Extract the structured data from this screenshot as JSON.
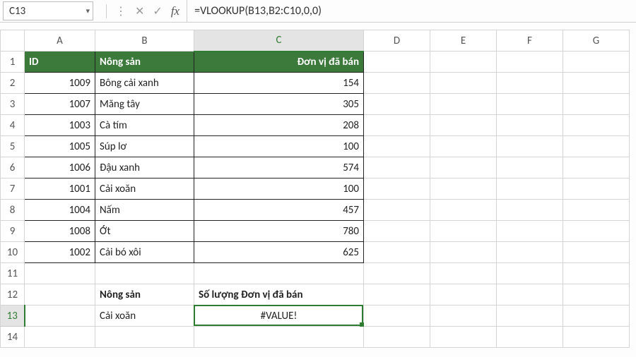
{
  "formula_bar": {
    "cell_ref": "C13",
    "formula": "=VLOOKUP(B13,B2:C10,0,0)",
    "icon_cancel": "✕",
    "icon_accept": "✓",
    "icon_fx": "fx",
    "icon_dropdown": "▾",
    "icon_sep": "⋮"
  },
  "columns": [
    "A",
    "B",
    "C",
    "D",
    "E",
    "F",
    "G"
  ],
  "row_labels": [
    "1",
    "2",
    "3",
    "4",
    "5",
    "6",
    "7",
    "8",
    "9",
    "10",
    "11",
    "12",
    "13",
    "14"
  ],
  "header_row": {
    "A": "ID",
    "B": "Nông sản",
    "C": "Đơn vị đã bán"
  },
  "data_rows": [
    {
      "id": "1009",
      "name": "Bông cải xanh",
      "units": "154"
    },
    {
      "id": "1007",
      "name": "Măng tây",
      "units": "305"
    },
    {
      "id": "1003",
      "name": "Cà tím",
      "units": "208"
    },
    {
      "id": "1005",
      "name": "Súp lơ",
      "units": "100"
    },
    {
      "id": "1006",
      "name": "Đậu xanh",
      "units": "574"
    },
    {
      "id": "1001",
      "name": "Cải xoăn",
      "units": "100"
    },
    {
      "id": "1004",
      "name": "Nấm",
      "units": "457"
    },
    {
      "id": "1008",
      "name": "Ớt",
      "units": "780"
    },
    {
      "id": "1002",
      "name": "Cải bó xôi",
      "units": "625"
    }
  ],
  "lookup": {
    "label_b12": "Nông sản",
    "label_c12": "Số lượng Đơn vị đã bán",
    "value_b13": "Cải xoăn",
    "value_c13": "#VALUE!"
  },
  "selected": {
    "col": "C",
    "row": "13"
  }
}
